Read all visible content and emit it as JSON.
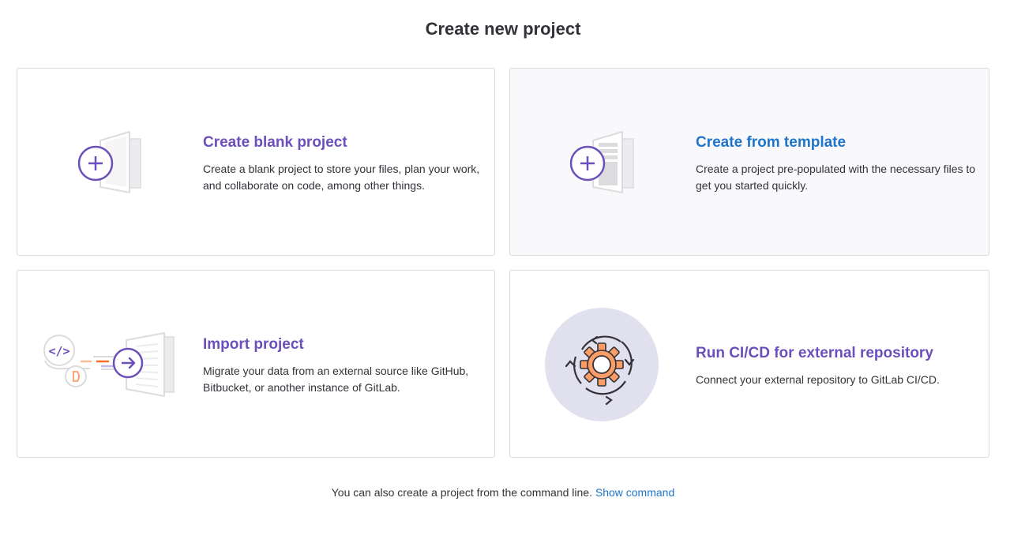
{
  "page": {
    "title": "Create new project"
  },
  "cards": [
    {
      "title": "Create blank project",
      "description": "Create a blank project to store your files, plan your work, and collaborate on code, among other things.",
      "icon": "blank-project-icon"
    },
    {
      "title": "Create from template",
      "description": "Create a project pre-populated with the necessary files to get you started quickly.",
      "icon": "template-project-icon"
    },
    {
      "title": "Import project",
      "description": "Migrate your data from an external source like GitHub, Bitbucket, or another instance of GitLab.",
      "icon": "import-project-icon"
    },
    {
      "title": "Run CI/CD for external repository",
      "description": "Connect your external repository to GitLab CI/CD.",
      "icon": "cicd-gear-icon"
    }
  ],
  "footer": {
    "text": "You can also create a project from the command line.",
    "link_label": "Show command"
  },
  "colors": {
    "purple": "#6b4fbb",
    "blue": "#1f75cb",
    "orange": "#fc9d65",
    "border": "#dcdcde"
  }
}
